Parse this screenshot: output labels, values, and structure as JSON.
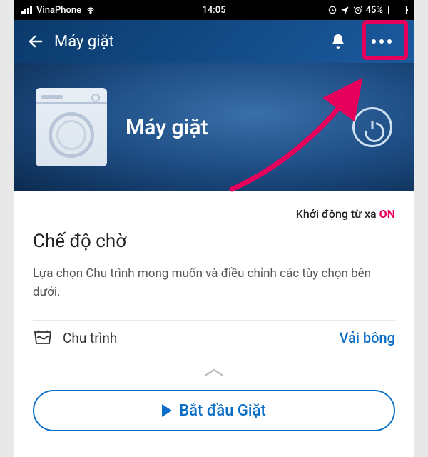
{
  "status_bar": {
    "carrier": "VinaPhone",
    "time": "14:05",
    "battery_pct": "45%"
  },
  "header": {
    "title": "Máy giặt"
  },
  "hero": {
    "device_name": "Máy giặt"
  },
  "content": {
    "remote_label": "Khởi động từ xa",
    "remote_state": "ON",
    "mode_title": "Chế độ chờ",
    "mode_description": "Lựa chọn Chu trình mong muốn và điều chỉnh các tùy chọn bên dưới.",
    "cycle_label": "Chu trình",
    "cycle_value": "Vải bông"
  },
  "start_button": {
    "label": "Bắt đầu Giặt"
  },
  "colors": {
    "accent": "#0a6ec7",
    "highlight": "#e6005c"
  }
}
